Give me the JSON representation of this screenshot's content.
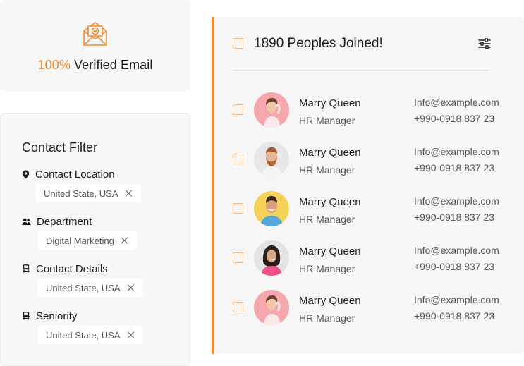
{
  "colors": {
    "accent": "#f28c2b",
    "card_bg": "#f7f7f7",
    "checkbox_border": "#f1b98a"
  },
  "verified": {
    "icon": "verified-envelope-icon",
    "percent": "100%",
    "label": "Verified Email"
  },
  "filter": {
    "title": "Contact Filter",
    "groups": [
      {
        "label": "Contact Location",
        "icon": "location-pin-icon",
        "chip": "United State, USA"
      },
      {
        "label": "Department",
        "icon": "people-icon",
        "chip": "Digital Marketing"
      },
      {
        "label": "Contact Details",
        "icon": "chair-icon",
        "chip": "United State, USA"
      },
      {
        "label": "Seniority",
        "icon": "chair-icon",
        "chip": "United State, USA"
      }
    ]
  },
  "panel": {
    "title": "1890 Peoples Joined!",
    "filter_icon": "sliders-icon",
    "contacts": [
      {
        "name": "Marry Queen",
        "role": "HR Manager",
        "email": "Info@example.com",
        "phone": "+990-0918 837 23",
        "avatar": "woman-pink-avatar"
      },
      {
        "name": "Marry Queen",
        "role": "HR Manager",
        "email": "Info@example.com",
        "phone": "+990-0918 837 23",
        "avatar": "bearded-man-avatar"
      },
      {
        "name": "Marry Queen",
        "role": "HR Manager",
        "email": "Info@example.com",
        "phone": "+990-0918 837 23",
        "avatar": "smiling-man-avatar"
      },
      {
        "name": "Marry Queen",
        "role": "HR Manager",
        "email": "Info@example.com",
        "phone": "+990-0918 837 23",
        "avatar": "woman-dark-hair-avatar"
      },
      {
        "name": "Marry Queen",
        "role": "HR Manager",
        "email": "Info@example.com",
        "phone": "+990-0918 837 23",
        "avatar": "woman-pink-avatar"
      }
    ]
  }
}
